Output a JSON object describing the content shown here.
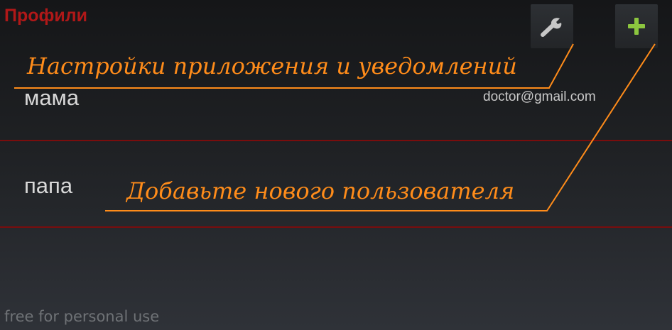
{
  "header": {
    "title": "Профили",
    "settings_icon": "wrench-icon",
    "add_icon": "plus-icon"
  },
  "profiles": [
    {
      "name": "мама",
      "email": "doctor@gmail.com"
    },
    {
      "name": "папа",
      "email": ""
    }
  ],
  "annotations": {
    "settings": "Настройки приложения и уведомлений",
    "add_user": "Добавьте нового пользователя"
  },
  "watermark": "free for personal use",
  "colors": {
    "title": "#b01818",
    "divider": "#7a0d0d",
    "annotation": "#ff8c1a",
    "add_icon": "#8cc63f"
  }
}
